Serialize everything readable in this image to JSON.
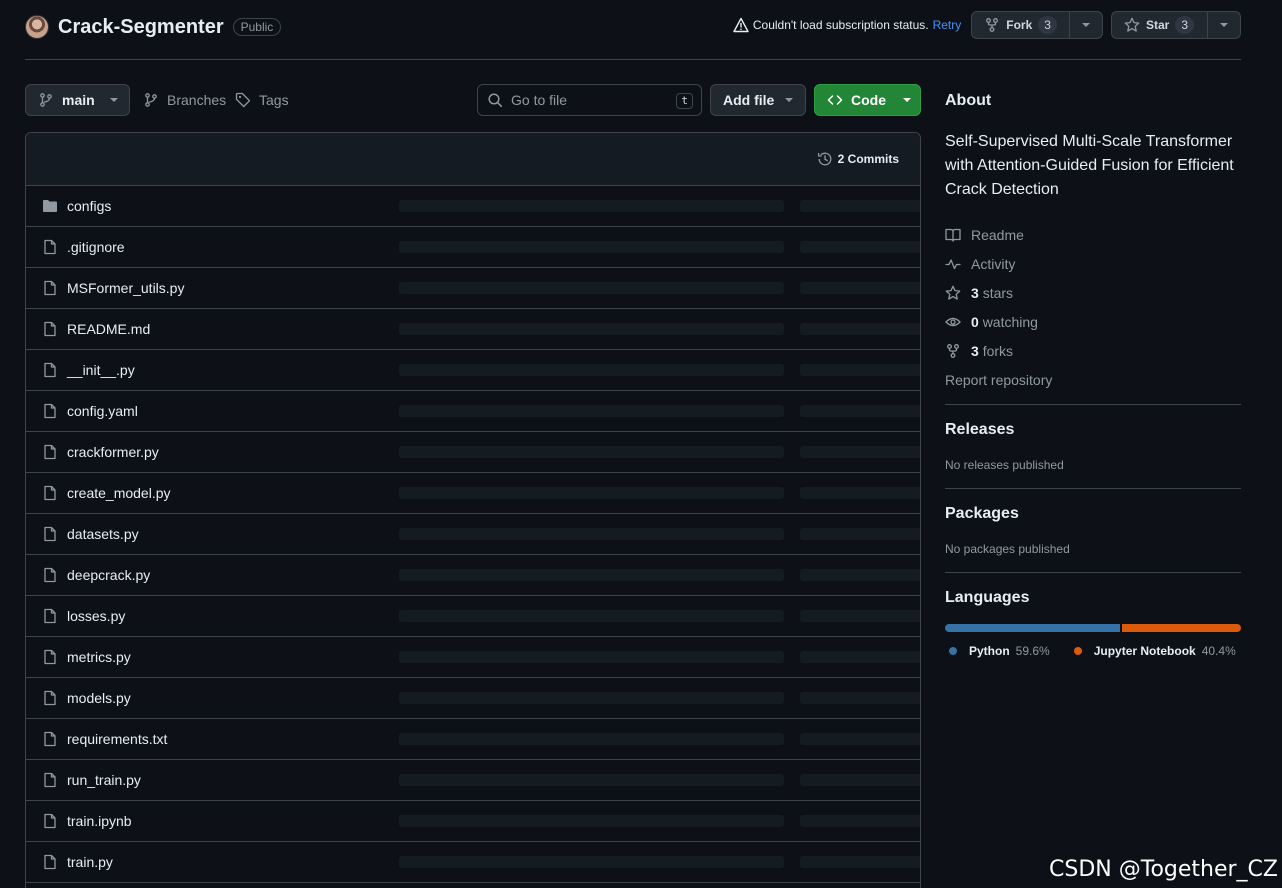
{
  "header": {
    "repo_name": "Crack-Segmenter",
    "visibility": "Public",
    "subscription_status": "Couldn't load subscription status.",
    "retry": "Retry",
    "fork_label": "Fork",
    "fork_count": "3",
    "star_label": "Star",
    "star_count": "3"
  },
  "toolbar": {
    "branch": "main",
    "branches_label": "Branches",
    "tags_label": "Tags",
    "goto_placeholder": "Go to file",
    "goto_shortcut": "t",
    "add_file": "Add file",
    "code": "Code"
  },
  "files": {
    "commits": "2 Commits",
    "items": [
      {
        "name": "configs",
        "type": "folder"
      },
      {
        "name": ".gitignore",
        "type": "file"
      },
      {
        "name": "MSFormer_utils.py",
        "type": "file"
      },
      {
        "name": "README.md",
        "type": "file"
      },
      {
        "name": "__init__.py",
        "type": "file"
      },
      {
        "name": "config.yaml",
        "type": "file"
      },
      {
        "name": "crackformer.py",
        "type": "file"
      },
      {
        "name": "create_model.py",
        "type": "file"
      },
      {
        "name": "datasets.py",
        "type": "file"
      },
      {
        "name": "deepcrack.py",
        "type": "file"
      },
      {
        "name": "losses.py",
        "type": "file"
      },
      {
        "name": "metrics.py",
        "type": "file"
      },
      {
        "name": "models.py",
        "type": "file"
      },
      {
        "name": "requirements.txt",
        "type": "file"
      },
      {
        "name": "run_train.py",
        "type": "file"
      },
      {
        "name": "train.ipynb",
        "type": "file"
      },
      {
        "name": "train.py",
        "type": "file"
      }
    ]
  },
  "sidebar": {
    "about_heading": "About",
    "description": "Self-Supervised Multi-Scale Transformer with Attention-Guided Fusion for Efficient Crack Detection",
    "readme": "Readme",
    "activity": "Activity",
    "stars_count": "3",
    "stars_label": "stars",
    "watching_count": "0",
    "watching_label": "watching",
    "forks_count": "3",
    "forks_label": "forks",
    "report": "Report repository",
    "releases_heading": "Releases",
    "releases_text": "No releases published",
    "packages_heading": "Packages",
    "packages_text": "No packages published",
    "languages_heading": "Languages",
    "languages": [
      {
        "name": "Python",
        "percent": "59.6%",
        "value": 59.6,
        "color": "#3572A5"
      },
      {
        "name": "Jupyter Notebook",
        "percent": "40.4%",
        "value": 40.4,
        "color": "#DA5B0B"
      }
    ]
  },
  "watermark": "CSDN @Together_CZ"
}
